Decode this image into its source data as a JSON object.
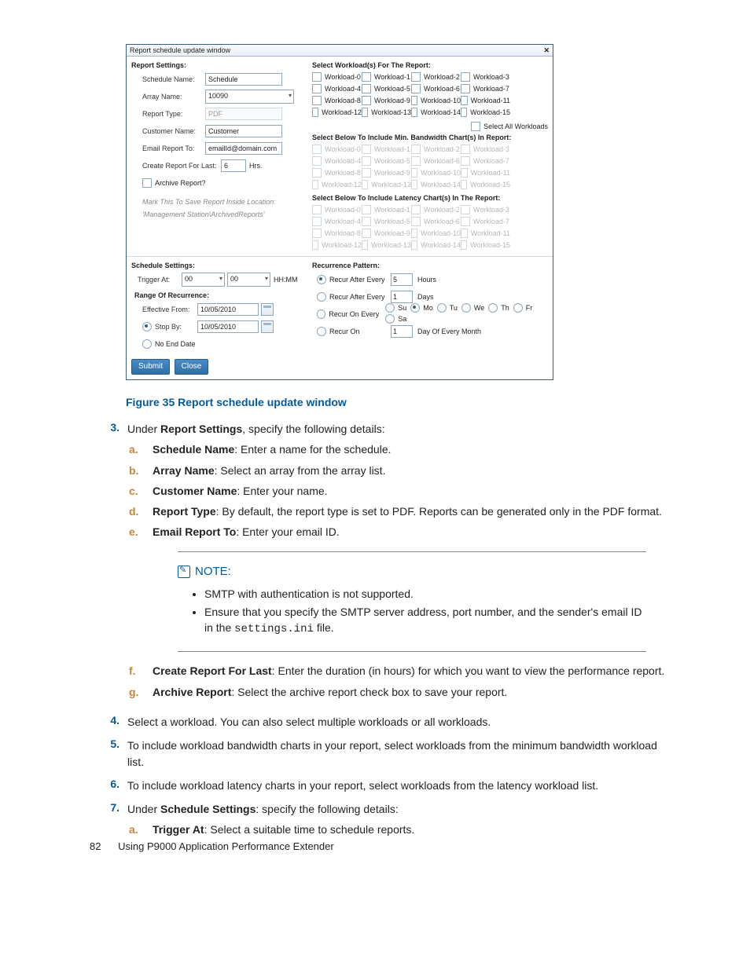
{
  "dialog": {
    "title": "Report schedule update window",
    "report_settings_head": "Report Settings:",
    "fields": {
      "schedule_name_label": "Schedule Name:",
      "schedule_name_value": "Schedule",
      "array_name_label": "Array Name:",
      "array_name_value": "10090",
      "report_type_label": "Report Type:",
      "report_type_value": "PDF",
      "customer_name_label": "Customer Name:",
      "customer_name_value": "Customer",
      "email_label": "Email Report To:",
      "email_value": "emailId@domain.com",
      "create_last_label": "Create Report For Last:",
      "create_last_value": "6",
      "create_last_unit": "Hrs.",
      "archive_label": "Archive Report?",
      "note1": "Mark This To Save Report Inside Location:",
      "note2": "'Management Station\\ArchivedReports'"
    },
    "right": {
      "workloads_head": "Select Workload(s) For The Report:",
      "select_all": "Select All Workloads",
      "bandwidth_head": "Select Below To Include Min. Bandwidth Chart(s) In Report:",
      "latency_head": "Select Below To Include Latency Chart(s) In The Report:"
    },
    "workloads": [
      "Workload-0",
      "Workload-1",
      "Workload-2",
      "Workload-3",
      "Workload-4",
      "Workload-5",
      "Workload-6",
      "Workload-7",
      "Workload-8",
      "Workload-9",
      "Workload-10",
      "Workload-11",
      "Workload-12",
      "Workload-13",
      "Workload-14",
      "Workload-15"
    ],
    "schedule_settings_head": "Schedule Settings:",
    "trigger": {
      "label": "Trigger At:",
      "hh": "00",
      "mm": "00",
      "suffix": "HH:MM"
    },
    "range": {
      "head": "Range Of Recurrence:",
      "from_label": "Effective From:",
      "from_value": "10/05/2010",
      "stop_label": "Stop By:",
      "stop_value": "10/05/2010",
      "noend_label": "No End Date"
    },
    "recur": {
      "head": "Recurrence Pattern:",
      "every_hours_label": "Recur After Every",
      "every_hours_value": "5",
      "hours_unit": "Hours",
      "every_days_label": "Recur After Every",
      "every_days_value": "1",
      "days_unit": "Days",
      "on_every_label": "Recur On Every",
      "days": [
        "Su",
        "Mo",
        "Tu",
        "We",
        "Th",
        "Fr",
        "Sa"
      ],
      "on_label": "Recur On",
      "on_value": "1",
      "on_suffix": "Day Of Every Month"
    },
    "buttons": {
      "submit": "Submit",
      "close": "Close"
    }
  },
  "caption": "Figure 35 Report schedule update window",
  "step3_intro_pre": "Under ",
  "step3_intro_bold": "Report Settings",
  "step3_intro_post": ", specify the following details:",
  "sub": {
    "a_bold": "Schedule Name",
    "a_text": ": Enter a name for the schedule.",
    "b_bold": "Array Name",
    "b_text": ": Select an array from the array list.",
    "c_bold": "Customer Name",
    "c_text": ": Enter your name.",
    "d_bold": "Report Type",
    "d_text": ": By default, the report type is set to PDF. Reports can be generated only in the PDF format.",
    "e_bold": "Email Report To",
    "e_text": ": Enter your email ID.",
    "f_bold": "Create Report For Last",
    "f_text": ": Enter the duration (in hours) for which you want to view the performance report.",
    "g_bold": "Archive Report",
    "g_text": ": Select the archive report check box to save your report."
  },
  "note": {
    "head": "NOTE:",
    "li1": "SMTP with authentication is not supported.",
    "li2_pre": "Ensure that you specify the SMTP server address, port number, and the sender's email ID in the ",
    "li2_code": "settings.ini",
    "li2_post": " file."
  },
  "step4": "Select a workload. You can also select multiple workloads or all workloads.",
  "step5": "To include workload bandwidth charts in your report, select workloads from the minimum bandwidth workload list.",
  "step6": "To include workload latency charts in your report, select workloads from the latency workload list.",
  "step7_pre": "Under ",
  "step7_bold": "Schedule Settings",
  "step7_post": ": specify the following details:",
  "step7a_bold": "Trigger At",
  "step7a_text": ": Select a suitable time to schedule reports.",
  "footer": {
    "page": "82",
    "title": "Using P9000 Application Performance Extender"
  },
  "markers": {
    "s3": "3.",
    "s4": "4.",
    "s5": "5.",
    "s6": "6.",
    "s7": "7.",
    "a": "a.",
    "b": "b.",
    "c": "c.",
    "d": "d.",
    "e": "e.",
    "f": "f.",
    "g": "g."
  }
}
